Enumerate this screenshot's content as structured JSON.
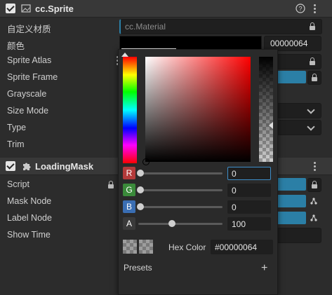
{
  "sprite_component": {
    "title": "cc.Sprite",
    "properties": [
      {
        "label": "自定义材质",
        "value": "cc.Material"
      },
      {
        "label": "颜色",
        "value": "00000064"
      },
      {
        "label": "Sprite Atlas"
      },
      {
        "label": "Sprite Frame"
      },
      {
        "label": "Grayscale"
      },
      {
        "label": "Size Mode"
      },
      {
        "label": "Type"
      },
      {
        "label": "Trim"
      }
    ]
  },
  "loading_mask_component": {
    "title": "LoadingMask",
    "properties": [
      {
        "label": "Script"
      },
      {
        "label": "Mask Node"
      },
      {
        "label": "Label Node"
      },
      {
        "label": "Show Time"
      }
    ]
  },
  "color_picker": {
    "channels": [
      {
        "letter": "R",
        "value": "0",
        "color": "#b33a3a"
      },
      {
        "letter": "G",
        "value": "0",
        "color": "#3a8a3a"
      },
      {
        "letter": "B",
        "value": "0",
        "color": "#3a6eb3"
      },
      {
        "letter": "A",
        "value": "100",
        "color": "#3a3a3a"
      }
    ],
    "slider_levels": {
      "R": 0,
      "G": 0,
      "B": 0,
      "A": 0.39
    },
    "hex_label": "Hex Color",
    "hex_value": "#00000064",
    "presets_label": "Presets",
    "add_preset_symbol": "+",
    "current_color": "#000000",
    "current_alpha_percent": 39
  },
  "icons": [
    "help-icon",
    "sprite-icon",
    "puzzle-icon",
    "lock-icon",
    "more-icon",
    "chevron-down-icon",
    "node-icon",
    "plus-icon"
  ]
}
